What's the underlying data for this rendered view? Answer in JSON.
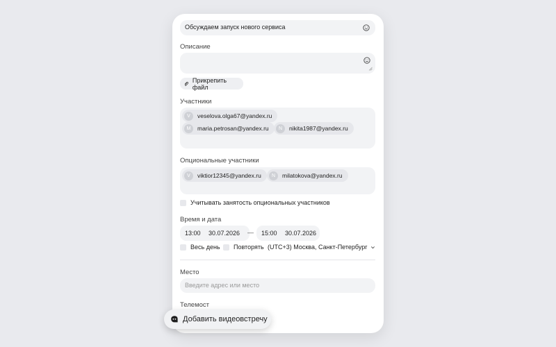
{
  "title_field": {
    "value": "Обсуждаем запуск нового сервиса",
    "icon": "smile-icon"
  },
  "description": {
    "label": "Описание",
    "value": "",
    "icon": "smile-icon"
  },
  "attach_button": {
    "label": "Прикрепить файл",
    "icon": "paperclip-icon"
  },
  "participants": {
    "label": "Участники",
    "chips": [
      {
        "initial": "V",
        "email": "veselova.olga67@yandex.ru"
      },
      {
        "initial": "M",
        "email": "maria.petrosan@yandex.ru"
      },
      {
        "initial": "N",
        "email": "nikita1987@yandex.ru"
      }
    ]
  },
  "optional_participants": {
    "label": "Опциональные участники",
    "chips": [
      {
        "initial": "V",
        "email": "viktior12345@yandex.ru"
      },
      {
        "initial": "N",
        "email": "milatokova@yandex.ru"
      }
    ]
  },
  "consider_busy": {
    "label": "Учитывать занятость опциональных участников",
    "checked": false
  },
  "datetime": {
    "label": "Время и дата",
    "start_time": "13:00",
    "start_date": "30.07.2026",
    "separator": "—",
    "end_time": "15:00",
    "end_date": "30.07.2026",
    "all_day_label": "Весь день",
    "all_day_checked": false,
    "repeat_label": "Повторять",
    "repeat_checked": false,
    "timezone": "(UTC+3) Москва, Санкт-Петербург"
  },
  "place": {
    "label": "Место",
    "placeholder": "Введите адрес или место"
  },
  "telemost": {
    "label": "Телемост"
  },
  "video_button": {
    "label": "Добавить видеовстречу",
    "icon": "telemost-icon"
  },
  "colors": {
    "background": "#e9eaee",
    "card": "#ffffff",
    "field": "#f2f3f5",
    "chip": "#e6e7eb"
  }
}
